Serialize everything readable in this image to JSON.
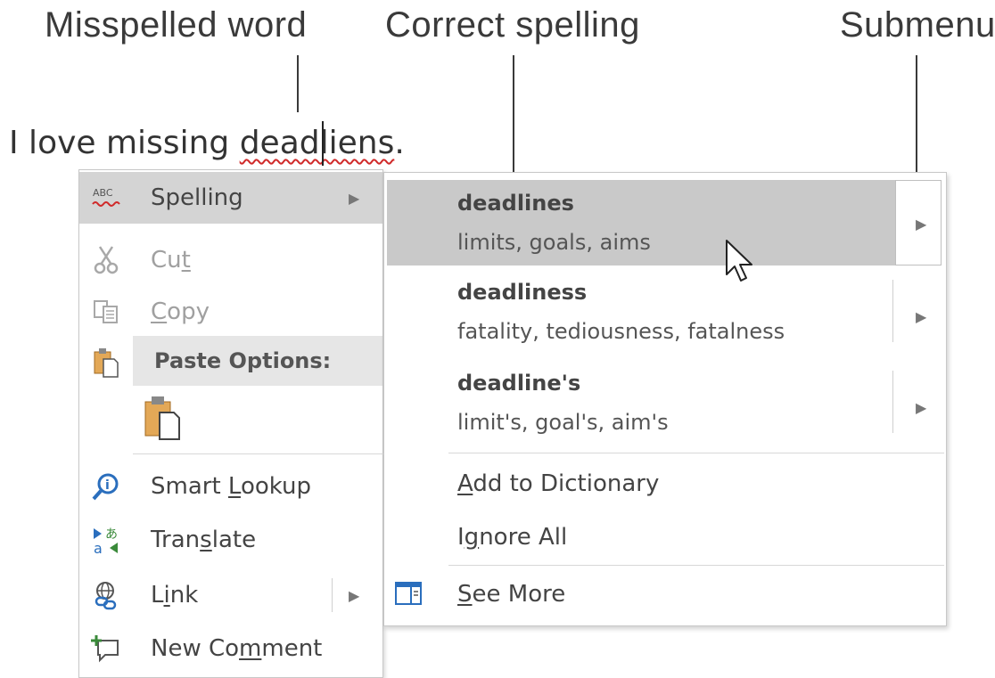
{
  "callouts": {
    "misspelled": "Misspelled word",
    "correct": "Correct spelling",
    "submenu": "Submenu"
  },
  "document": {
    "before": "I love missing ",
    "misspelled_word": "deadliens",
    "after": "."
  },
  "context_menu": {
    "spelling": {
      "label": "Spelling",
      "icon": "spelling-abc-icon"
    },
    "cut": {
      "pre": "Cu",
      "u": "t",
      "post": "",
      "icon": "scissors-icon",
      "enabled": false
    },
    "copy": {
      "pre": "",
      "u": "C",
      "post": "opy",
      "icon": "copy-icon",
      "enabled": false
    },
    "paste_options": {
      "label": "Paste Options:",
      "icon": "paste-icon"
    },
    "smart_lookup": {
      "pre": "Smart ",
      "u": "L",
      "post": "ookup",
      "icon": "smart-lookup-icon"
    },
    "translate": {
      "pre": "Tran",
      "u": "s",
      "post": "late",
      "icon": "translate-icon"
    },
    "link": {
      "pre": "L",
      "u": "i",
      "post": "nk",
      "icon": "link-icon"
    },
    "new_comment": {
      "pre": "New Co",
      "u": "m",
      "post": "ment",
      "icon": "new-comment-icon"
    }
  },
  "spelling_submenu": {
    "suggestions": [
      {
        "word": "deadlines",
        "synonyms": "limits, goals, aims",
        "highlighted": true
      },
      {
        "word": "deadliness",
        "synonyms": "fatality, tediousness, fatalness",
        "highlighted": false
      },
      {
        "word": "deadline's",
        "synonyms": "limit's, goal's, aim's",
        "highlighted": false
      }
    ],
    "add_to_dictionary": {
      "pre": "",
      "u": "A",
      "post": "dd to Dictionary"
    },
    "ignore_all": {
      "pre": "I",
      "u": "g",
      "post": "nore All"
    },
    "see_more": {
      "pre": "",
      "u": "S",
      "post": "ee More",
      "icon": "see-more-pane-icon"
    }
  },
  "colors": {
    "highlight": "#c9c9c9",
    "squiggle": "#d02a2a",
    "paste_icon": "#e3a857"
  }
}
